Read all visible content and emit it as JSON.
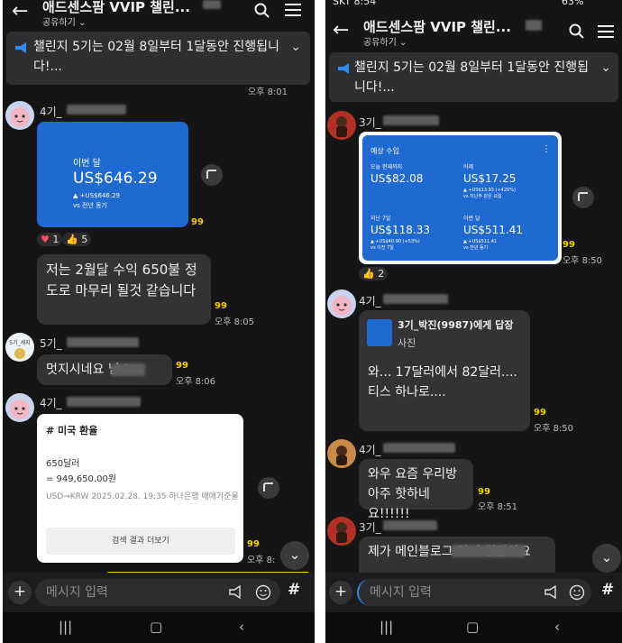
{
  "left": {
    "header": {
      "title": "애드센스팜 VVIP 챌린...",
      "subtitle": "공유하기"
    },
    "notice": {
      "text": "챌린지 5기는 02월 8일부터 1달동안 진행됩니다!..."
    },
    "top_time": "오후 8:01",
    "msg1": {
      "sender": "4기_",
      "card": {
        "label": "이번 달",
        "amount": "US$646.29",
        "delta": "▲ +US$646.29",
        "compare": "vs 전년 동기"
      },
      "unread": "99",
      "reactions": [
        {
          "icon": "heart-icon",
          "count": "1"
        },
        {
          "icon": "thumbs-up-icon",
          "count": "5"
        }
      ]
    },
    "msg2": {
      "text": "저는 2월달 수익 650불 정도로 마무리 될것 같습니다",
      "unread": "99",
      "time": "오후 8:05"
    },
    "msg3": {
      "sender": "5기_",
      "avatar_text": "5기_세지",
      "text": "멋지시네요 님 !",
      "unread": "99",
      "time": "오후 8:06"
    },
    "msg4": {
      "sender": "4기_",
      "card": {
        "title": "# 미국 환율",
        "line1": "650달러",
        "line2": "= 949,650.00원",
        "source": "USD→KRW 2025.02.28. 19:35 하나은행 매매기준율",
        "button": "검색 결과 더보기"
      },
      "unread": "99",
      "time": "오후 8:"
    },
    "input": {
      "placeholder": "메시지 입력"
    }
  },
  "right": {
    "status": {
      "carrier": "SKT 8:54",
      "battery": "63%"
    },
    "header": {
      "title": "애드센스팜 VVIP 챌린...",
      "subtitle": "공유하기"
    },
    "notice": {
      "text": "챌린지 5기는 02월 8일부터 1달동안 진행됩니다!..."
    },
    "msg1": {
      "sender": "3기_",
      "card": {
        "title": "예상 수입",
        "cells": [
          {
            "label": "오늘 현재까지",
            "value": "US$82.08",
            "delta": "",
            "compare": ""
          },
          {
            "label": "어제",
            "value": "US$17.25",
            "delta": "▲ +US$13.93 (+420%)",
            "compare": "vs 지난주 같은 요일"
          },
          {
            "label": "지난 7일",
            "value": "US$118.33",
            "delta": "▲ +US$40.90 (+53%)",
            "compare": "vs 이전 7일"
          },
          {
            "label": "이번 달",
            "value": "US$511.41",
            "delta": "▲ +US$511.41",
            "compare": "vs 전년 동기"
          }
        ]
      },
      "unread": "99",
      "time": "오후 8:50",
      "reaction_count": "2"
    },
    "msg2": {
      "sender": "4기_",
      "reply_to": "3기_박진(9987)에게 답장",
      "reply_type": "사진",
      "text": "와... 17달러에서 82달러.... 티스 하나로....",
      "unread": "99",
      "time": "오후 8:50"
    },
    "msg3": {
      "sender": "4기_",
      "text": "와우 요즘 우리방 아주 핫하네요!!!!!!",
      "unread": "99",
      "time": "오후 8:51"
    },
    "msg4": {
      "sender": "3기_",
      "text": "제가 메인블로그 라서 없잖아요"
    },
    "input": {
      "placeholder": "메시지 입력"
    }
  },
  "colors": {
    "background": "#151515",
    "bubble": "#333335",
    "card_blue": "#1f6ad1",
    "unread": "#f5d000",
    "accent_notice": "#2d8cf0"
  }
}
